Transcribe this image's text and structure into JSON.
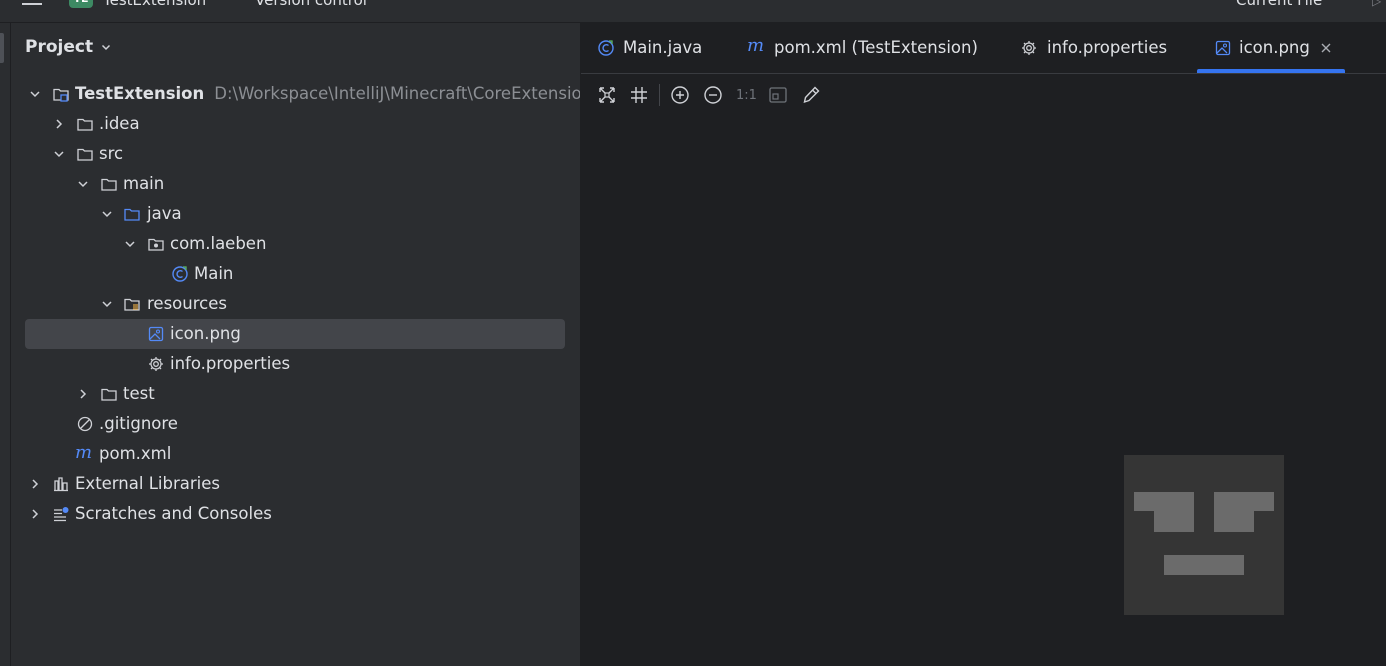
{
  "topbar": {
    "project_badge": "TE",
    "project_name": "TestExtension",
    "vcs_menu": "Version control",
    "run_config": "Current File"
  },
  "project_panel": {
    "title": "Project",
    "tree": [
      {
        "label": "TestExtension",
        "path": "D:\\Workspace\\IntelliJ\\Minecraft\\CoreExtensions"
      },
      {
        "label": ".idea"
      },
      {
        "label": "src"
      },
      {
        "label": "main"
      },
      {
        "label": "java"
      },
      {
        "label": "com.laeben"
      },
      {
        "label": "Main"
      },
      {
        "label": "resources"
      },
      {
        "label": "icon.png"
      },
      {
        "label": "info.properties"
      },
      {
        "label": "test"
      },
      {
        "label": ".gitignore"
      },
      {
        "label": "pom.xml"
      },
      {
        "label": "External Libraries"
      },
      {
        "label": "Scratches and Consoles"
      }
    ]
  },
  "editor": {
    "tabs": [
      {
        "label": "Main.java"
      },
      {
        "label": "pom.xml (TestExtension)"
      },
      {
        "label": "info.properties"
      },
      {
        "label": "icon.png"
      }
    ],
    "active_tab": "icon.png",
    "toolbar": {
      "zoom_actual": "1:1"
    }
  },
  "colors": {
    "accent": "#3574f0",
    "panel_bg": "#2b2d30",
    "editor_bg": "#1e1f22",
    "selection": "#43454a"
  }
}
